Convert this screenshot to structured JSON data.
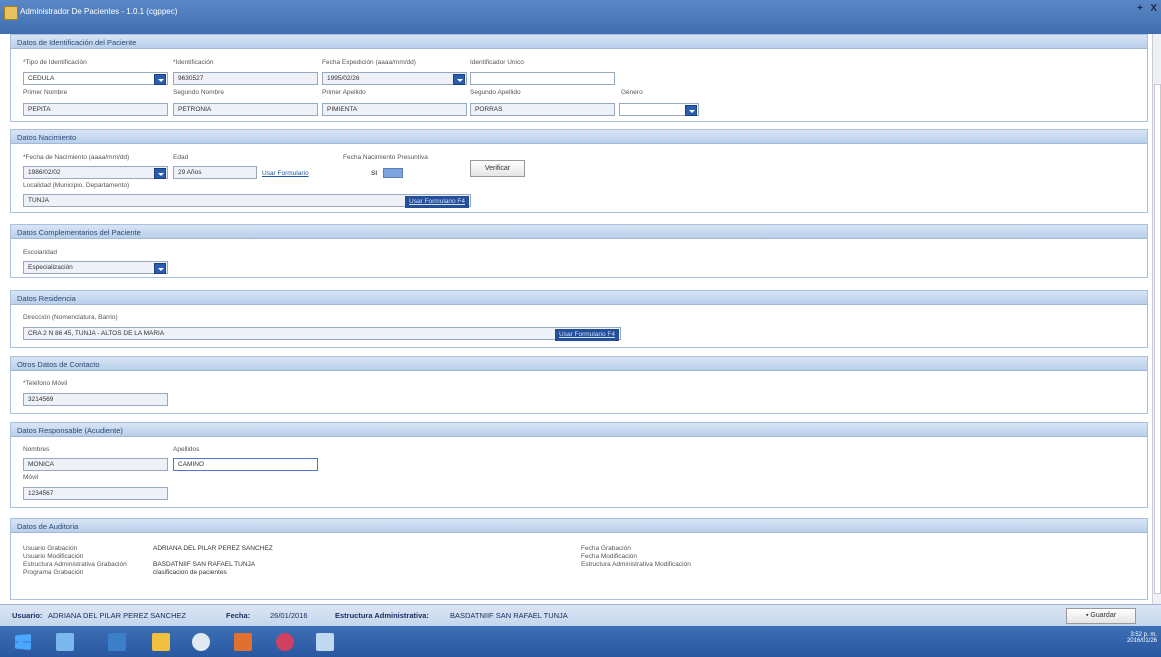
{
  "window": {
    "title": "Administrador De Pacientes - 1.0.1 (cgppec)",
    "pin": "+",
    "close": "X"
  },
  "ident": {
    "header": "Datos de Identificación del Paciente",
    "tipo_label": "*Tipo de Identificación",
    "tipo_value": "CEDULA",
    "ident_label": "*Identificación",
    "ident_value": "9630527",
    "fecha_label": "Fecha Expedición (aaaa/mm/dd)",
    "fecha_value": "1995/02/26",
    "unico_label": "Identificador Unico",
    "unico_value": "",
    "pnombre_label": "Primer Nombre",
    "pnombre_value": "PEPITA",
    "snombre_label": "Segundo Nombre",
    "snombre_value": "PETRONIA",
    "papellido_label": "Primer Apellido",
    "papellido_value": "PIMIENTA",
    "sapellido_label": "Segundo Apellido",
    "sapellido_value": "PORRAS",
    "genero_label": "Género",
    "genero_value": ""
  },
  "nac": {
    "header": "Datos Nacimiento",
    "fecha_label": "*Fecha de Nacimiento (aaaa/mm/dd)",
    "fecha_value": "1986/02/02",
    "edad_label": "Edad",
    "edad_value": "29 Años",
    "usar_form": "Usar Formulario",
    "presuntiva_label": "Fecha Nacimiento Presuntiva",
    "si_label": "SI",
    "verificar": "Verificar",
    "localidad_label": "Localidad (Municipio, Departamento)",
    "localidad_value": "TUNJA",
    "usar_form_f4": "Usar Formulario F4"
  },
  "comp": {
    "header": "Datos Complementarios del Paciente",
    "esc_label": "Escolaridad",
    "esc_value": "Especialización"
  },
  "res": {
    "header": "Datos Residencia",
    "dir_label": "Dirección (Nomenclatura, Barrio)",
    "dir_value": "CRA 2 N 86 45, TUNJA - ALTOS DE LA MARIA",
    "usar_form_f4": "Usar Formulario F4"
  },
  "contacto": {
    "header": "Otros Datos de Contacto",
    "tel_label": "*Teléfono Móvil",
    "tel_value": "3214569"
  },
  "resp": {
    "header": "Datos Responsable (Acudiente)",
    "nombres_label": "Nombres",
    "nombres_value": "MONICA",
    "apellidos_label": "Apellidos",
    "apellidos_value": "CAMINO",
    "movil_label": "Móvil",
    "movil_value": "1234567"
  },
  "audit": {
    "header": "Datos de Auditoria",
    "ug_label": "Usuario Grabación",
    "ug_value": "ADRIANA DEL PILAR PEREZ SANCHEZ",
    "um_label": "Usuario Modificación",
    "um_value": "",
    "eag_label": "Estructura Administrativa Grabación",
    "eag_value": "BASDATNIIF SAN RAFAEL TUNJA",
    "pg_label": "Programa Grabación",
    "pg_value": "clasificacion de pacientes",
    "fg_label": "Fecha Grabación",
    "fm_label": "Fecha Modificación",
    "eam_label": "Estructura Administrativa Modificación"
  },
  "status": {
    "usuario_label": "Usuario:",
    "usuario_value": "ADRIANA DEL PILAR PEREZ SANCHEZ",
    "fecha_label": "Fecha:",
    "fecha_value": "26/01/2016",
    "estructura_label": "Estructura Administrativa:",
    "estructura_value": "BASDATNIIF SAN RAFAEL TUNJA",
    "guardar": "Guardar"
  },
  "tray": {
    "time": "3:52 p. m.",
    "date": "2016/01/26"
  },
  "colors": {
    "accent": "#2a5db0",
    "header_bg": "#c8daf0",
    "taskbar": "#2f5fa8"
  }
}
